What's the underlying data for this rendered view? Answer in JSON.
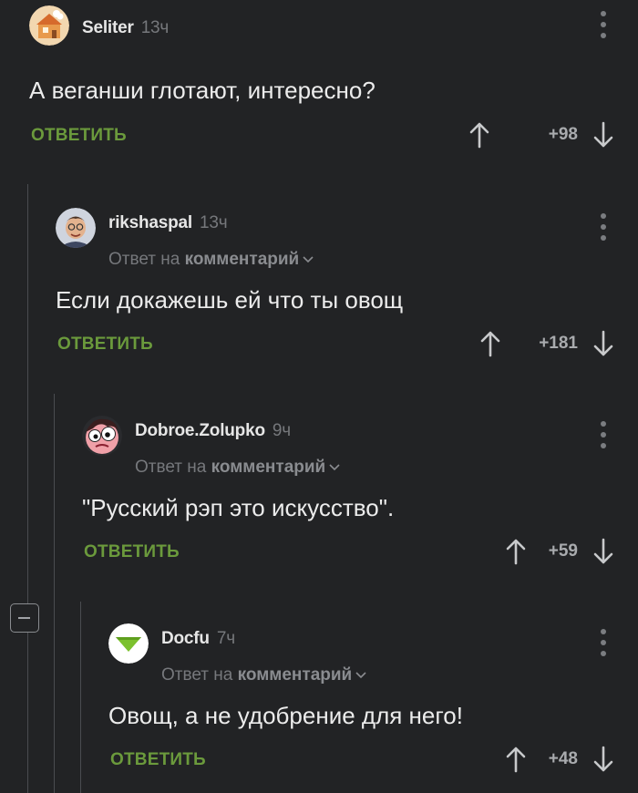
{
  "comments": [
    {
      "author": "Seliter",
      "time": "13ч",
      "text": "А веганши глотают, интересно?",
      "reply_label": "ОТВЕТИТЬ",
      "score": "+98"
    },
    {
      "author": "rikshaspal",
      "time": "13ч",
      "reply_to_prefix": "Ответ на",
      "reply_to_target": "комментарий",
      "text": "Если докажешь ей что ты овощ",
      "reply_label": "ОТВЕТИТЬ",
      "score": "+181"
    },
    {
      "author": "Dobroe.Zolupko",
      "time": "9ч",
      "reply_to_prefix": "Ответ на",
      "reply_to_target": "комментарий",
      "text": "\"Русский рэп это искусство\".",
      "reply_label": "ОТВЕТИТЬ",
      "score": "+59"
    },
    {
      "author": "Docfu",
      "time": "7ч",
      "reply_to_prefix": "Ответ на",
      "reply_to_target": "комментарий",
      "text": "Овощ, а не удобрение для него!",
      "reply_label": "ОТВЕТИТЬ",
      "score": "+48"
    }
  ],
  "colors": {
    "background": "#222325",
    "reply_green": "#6b9a3c",
    "muted": "#76787c"
  },
  "icons": [
    "more-vertical-icon",
    "arrow-up-icon",
    "arrow-down-icon",
    "chevron-down-icon",
    "collapse-minus-icon"
  ]
}
